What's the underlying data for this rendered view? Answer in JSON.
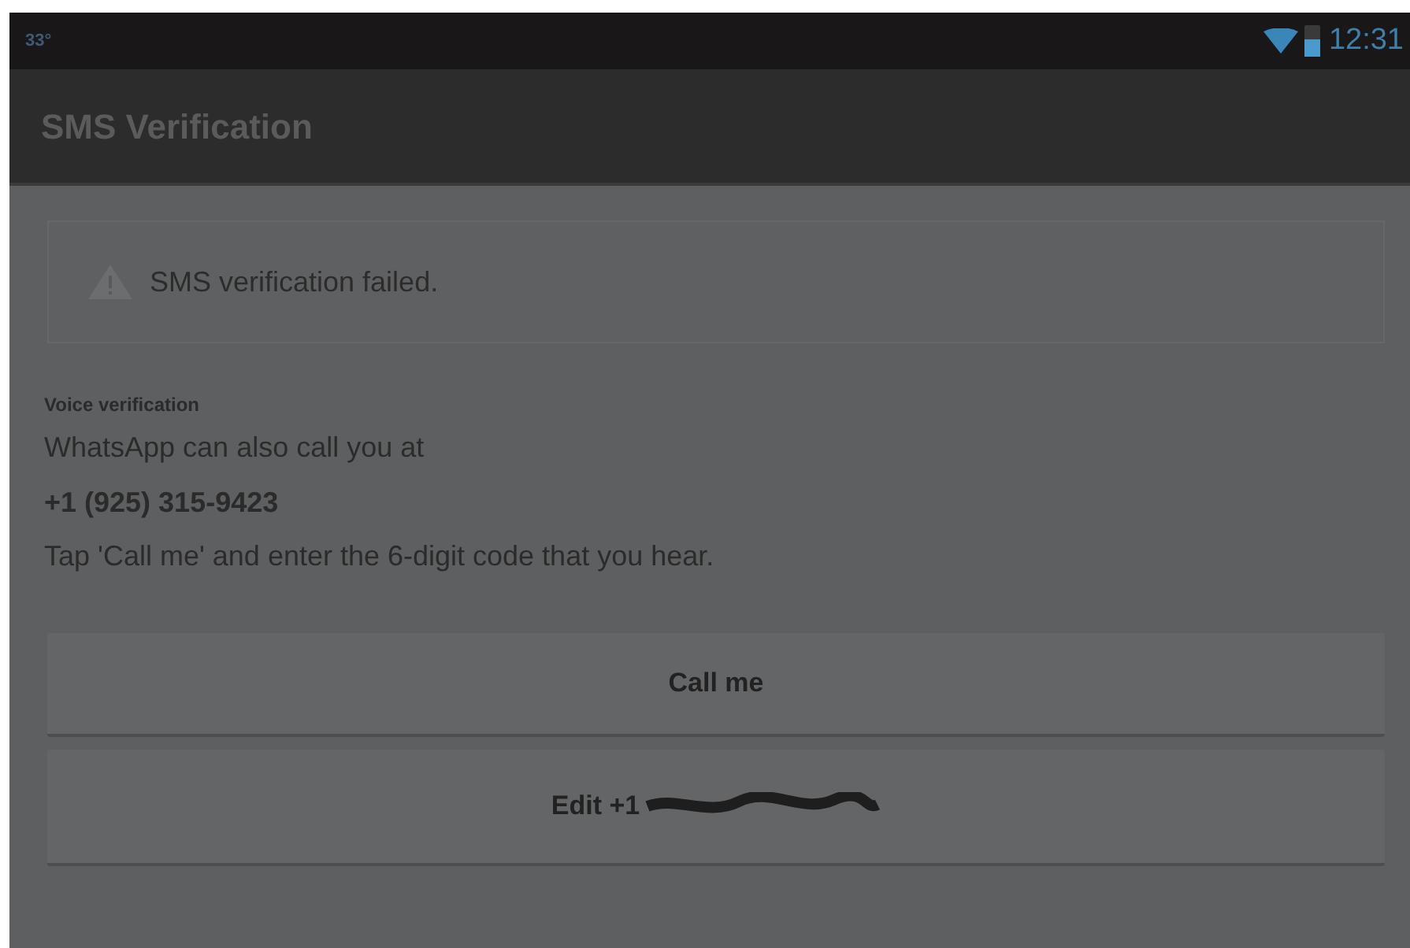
{
  "status_bar": {
    "notification": "33°",
    "time": "12:31"
  },
  "window": {
    "title": "SMS Verification"
  },
  "alert": {
    "message": "SMS verification failed."
  },
  "section": {
    "heading": "Voice verification",
    "lines": [
      "WhatsApp can also call you at",
      "+1 (925) 315-9423",
      "Tap 'Call me' and enter the 6-digit code that you hear."
    ]
  },
  "buttons": [
    {
      "label": "Call me",
      "redacted": false
    },
    {
      "label": "Edit +1",
      "redacted": true
    }
  ]
}
